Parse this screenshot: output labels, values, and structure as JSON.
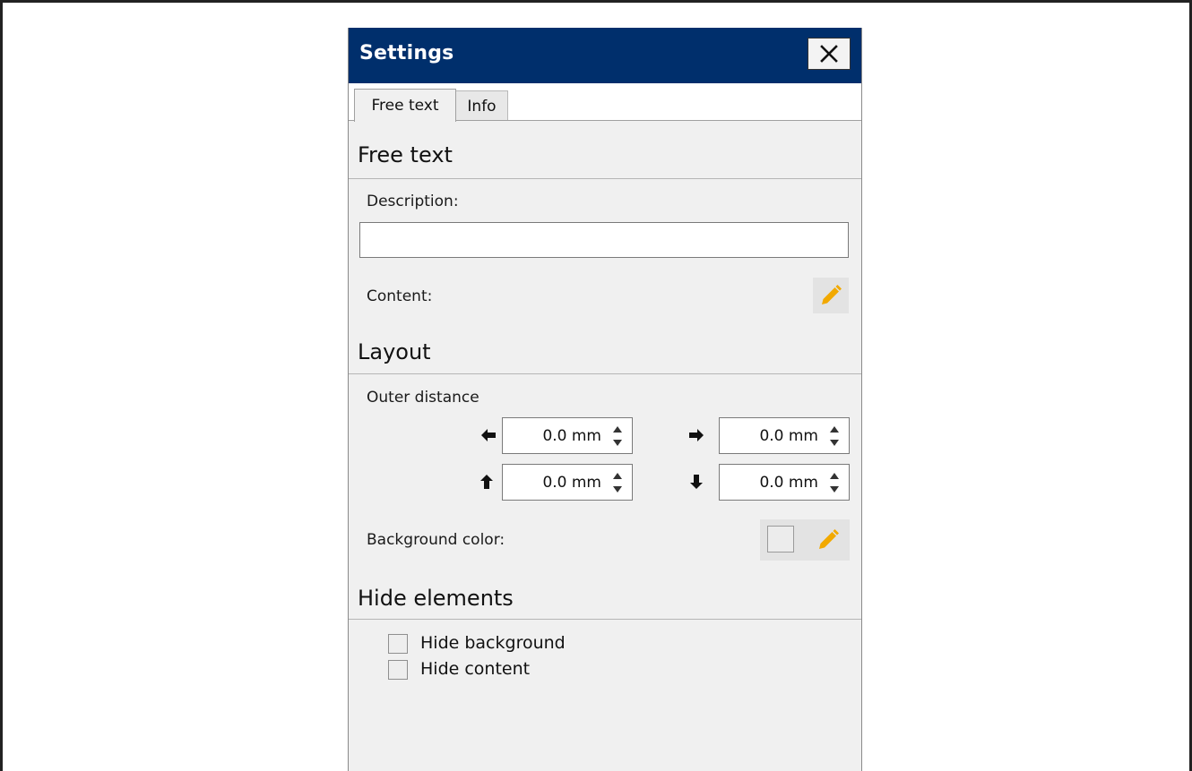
{
  "window": {
    "title": "Settings"
  },
  "tabs": [
    {
      "label": "Free text",
      "active": true
    },
    {
      "label": "Info",
      "active": false
    }
  ],
  "free_text_section": {
    "heading": "Free text",
    "description_label": "Description:",
    "description_value": "",
    "content_label": "Content:"
  },
  "layout_section": {
    "heading": "Layout",
    "outer_distance_label": "Outer distance",
    "left_value": "0.0 mm",
    "right_value": "0.0 mm",
    "top_value": "0.0 mm",
    "bottom_value": "0.0 mm",
    "background_color_label": "Background color:"
  },
  "hide_elements_section": {
    "heading": "Hide elements",
    "options": [
      {
        "label": "Hide background",
        "checked": false
      },
      {
        "label": "Hide content",
        "checked": false
      }
    ]
  },
  "colors": {
    "titlebar": "#002f6c",
    "pencil": "#f2a900",
    "panel_bg": "#f0f0f0"
  }
}
